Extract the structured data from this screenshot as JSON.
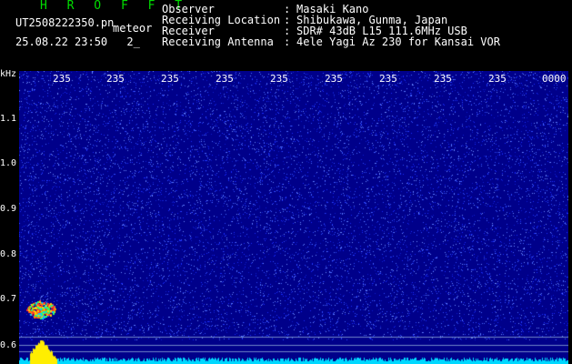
{
  "header": {
    "app_title": "H R O F F T",
    "filename": "UT2508222350.pn",
    "meteor_tag": "meteor",
    "datetime": "25.08.22 23:50",
    "count": "2_"
  },
  "info": {
    "labels": [
      "Observer",
      "Receiving Location",
      "Receiver",
      "Receiving Antenna"
    ],
    "colons": [
      ":",
      ":",
      ":",
      ":"
    ],
    "values": [
      "Masaki Kano",
      "Shibukawa, Gunma, Japan",
      "SDR# 43dB L15 111.6MHz USB",
      "4ele Yagi Az 230 for Kansai VOR"
    ]
  },
  "spectrogram": {
    "unit_label": "kHz",
    "y_ticks": [
      "1.1",
      "1.0",
      "0.9",
      "0.8",
      "0.7",
      "0.6"
    ],
    "x_ticks": [
      "235",
      "235",
      "235",
      "235",
      "235",
      "235",
      "235",
      "235",
      "235",
      "0000"
    ]
  },
  "colors": {
    "background": "#00008a",
    "title": "#00dd00",
    "noise": "#3b5bff",
    "baseline": "#00d8ff"
  }
}
